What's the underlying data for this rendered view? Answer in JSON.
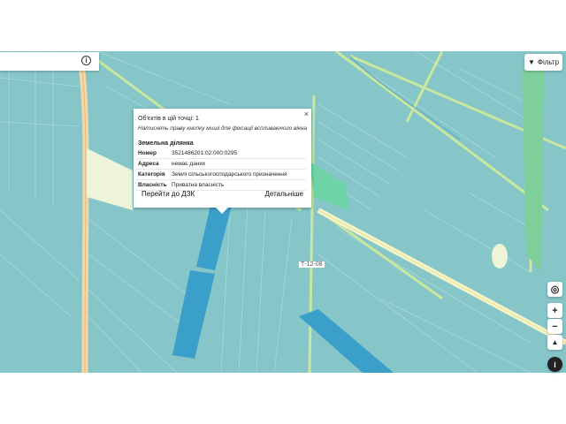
{
  "search": {
    "value": "",
    "placeholder": ""
  },
  "info_icon": "info-icon",
  "filter": {
    "label": "Фільтр",
    "icon": "filter-icon"
  },
  "popup": {
    "close": "×",
    "count_label": "Об'єктів в цій точці: 1",
    "hint": "Натисніть праву кнопку миші для фіксації вспливаючого вікна",
    "section_title": "Земельна ділянка",
    "rows": [
      {
        "key": "Номер",
        "value": "3521486201:02:000:0295"
      },
      {
        "key": "Адреса",
        "value": "немає даних"
      },
      {
        "key": "Категорія",
        "value": "Землі сільськогосподарського призначення"
      },
      {
        "key": "Власність",
        "value": "Приватна власність"
      }
    ],
    "btn_dzk": "Перейти до ДЗК",
    "btn_details": "Детальніше"
  },
  "road_label": "Т-12-08",
  "controls": {
    "locate": "◎",
    "zoom_in": "+",
    "zoom_out": "−",
    "compass": "▲",
    "info": "i"
  },
  "colors": {
    "parcel": "#86c6c9",
    "parcel_line": "#a5d6d8",
    "selected": "#3a9fc9",
    "road": "#f5d6a6",
    "road_green": "#c9e79e",
    "forest": "#6fd3a8"
  }
}
